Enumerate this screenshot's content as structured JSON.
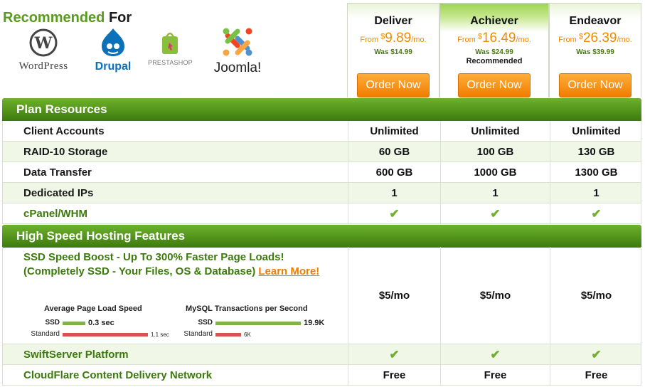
{
  "recommended": {
    "title_green": "Recommended",
    "title_black": "For"
  },
  "logos": [
    {
      "id": "wordpress",
      "name": "WordPress"
    },
    {
      "id": "drupal",
      "name": "Drupal"
    },
    {
      "id": "prestashop",
      "name": "PRESTASHOP"
    },
    {
      "id": "joomla",
      "name": "Joomla!"
    }
  ],
  "plans": [
    {
      "name": "Deliver",
      "from": "From",
      "dollar": "$",
      "price": "9.89",
      "per": "/mo.",
      "was": "Was $14.99",
      "badge": "",
      "order": "Order Now"
    },
    {
      "name": "Achiever",
      "from": "From",
      "dollar": "$",
      "price": "16.49",
      "per": "/mo.",
      "was": "Was $24.99",
      "badge": "Recommended",
      "order": "Order Now"
    },
    {
      "name": "Endeavor",
      "from": "From",
      "dollar": "$",
      "price": "26.39",
      "per": "/mo.",
      "was": "Was $39.99",
      "badge": "",
      "order": "Order Now"
    }
  ],
  "sections": {
    "resources": "Plan Resources",
    "features": "High Speed Hosting Features"
  },
  "resource_rows": [
    {
      "label": "Client Accounts",
      "values": [
        "Unlimited",
        "Unlimited",
        "Unlimited"
      ]
    },
    {
      "label": "RAID-10 Storage",
      "values": [
        "60 GB",
        "100 GB",
        "130 GB"
      ]
    },
    {
      "label": "Data Transfer",
      "values": [
        "600 GB",
        "1000 GB",
        "1300 GB"
      ]
    },
    {
      "label": "Dedicated IPs",
      "values": [
        "1",
        "1",
        "1"
      ]
    },
    {
      "label": "cPanel/WHM",
      "values": [
        "✔",
        "✔",
        "✔"
      ]
    }
  ],
  "ssd": {
    "line1": "SSD Speed Boost - Up To 300% Faster Page Loads!",
    "line2": "(Completely SSD - Your Files, OS & Database)",
    "link": "Learn More!",
    "values": [
      "$5/mo",
      "$5/mo",
      "$5/mo"
    ],
    "chart1": {
      "title": "Average Page Load Speed",
      "ssd_label": "SSD",
      "ssd_value": "0.3 sec",
      "std_label": "Standard",
      "std_value": "1.1 sec",
      "ssd_fraction": 0.27,
      "std_fraction": 1.0
    },
    "chart2": {
      "title": "MySQL Transactions per Second",
      "ssd_label": "SSD",
      "ssd_value": "19.9K",
      "std_label": "Standard",
      "std_value": "6K",
      "ssd_fraction": 1.0,
      "std_fraction": 0.3
    }
  },
  "feature_rows": [
    {
      "label": "SwiftServer Platform",
      "values": [
        "✔",
        "✔",
        "✔"
      ]
    },
    {
      "label": "CloudFlare Content Delivery Network",
      "values": [
        "Free",
        "Free",
        "Free"
      ]
    }
  ],
  "colors": {
    "accent_green": "#5a9a1e",
    "order_orange": "#f07d00",
    "bar_ssd": "#7fb34a",
    "bar_standard": "#d9534f"
  }
}
